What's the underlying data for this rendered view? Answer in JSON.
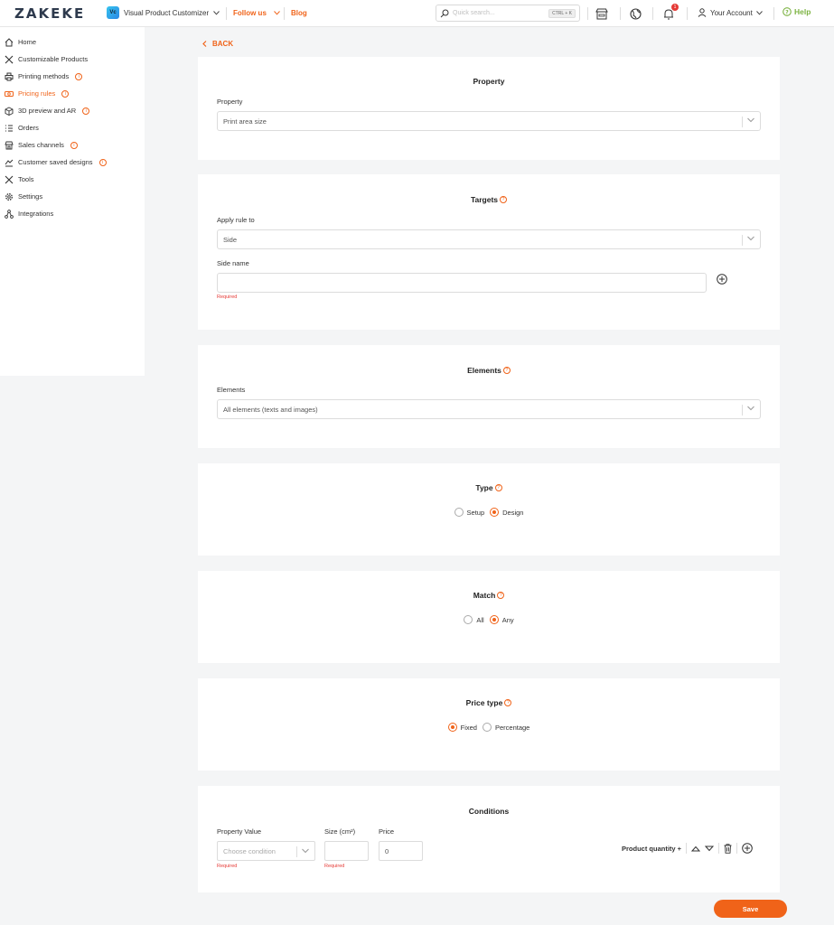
{
  "topbar": {
    "logo": "ZAKEKE",
    "app_badge": "Vc",
    "app_name": "Visual Product Customizer",
    "follow": "Follow us",
    "blog": "Blog",
    "search_placeholder": "Quick search...",
    "search_shortcut": "CTRL + K",
    "notification_count": "1",
    "account": "Your Account",
    "help": "Help"
  },
  "sidebar": {
    "items": [
      {
        "label": "Home",
        "icon": "home-icon"
      },
      {
        "label": "Customizable Products",
        "icon": "tools-icon"
      },
      {
        "label": "Printing methods",
        "icon": "printer-icon",
        "info": true
      },
      {
        "label": "Pricing rules",
        "icon": "price-tag-icon",
        "info": true,
        "active": true
      },
      {
        "label": "3D preview and AR",
        "icon": "cube-icon",
        "info": true
      },
      {
        "label": "Orders",
        "icon": "list-icon"
      },
      {
        "label": "Sales channels",
        "icon": "store-icon",
        "info": true
      },
      {
        "label": "Customer saved designs",
        "icon": "designs-icon",
        "info": true
      },
      {
        "label": "Tools",
        "icon": "wrench-icon"
      },
      {
        "label": "Settings",
        "icon": "gear-icon"
      },
      {
        "label": "Integrations",
        "icon": "integrations-icon"
      }
    ]
  },
  "back": "BACK",
  "property": {
    "title": "Property",
    "label": "Property",
    "value": "Print area size"
  },
  "targets": {
    "title": "Targets",
    "apply_label": "Apply rule to",
    "apply_value": "Side",
    "side_name_label": "Side name",
    "side_name_value": "",
    "required": "Required"
  },
  "elements": {
    "title": "Elements",
    "label": "Elements",
    "value": "All elements (texts and images)"
  },
  "type": {
    "title": "Type",
    "options": [
      {
        "label": "Setup",
        "selected": false
      },
      {
        "label": "Design",
        "selected": true
      }
    ]
  },
  "match": {
    "title": "Match",
    "options": [
      {
        "label": "All",
        "selected": false
      },
      {
        "label": "Any",
        "selected": true
      }
    ]
  },
  "price_type": {
    "title": "Price type",
    "options": [
      {
        "label": "Fixed",
        "selected": true
      },
      {
        "label": "Percentage",
        "selected": false
      }
    ]
  },
  "conditions": {
    "title": "Conditions",
    "property_value_label": "Property Value",
    "property_value_placeholder": "Choose condition",
    "size_label": "Size (cm²)",
    "size_value": "",
    "price_label": "Price",
    "price_value": "0",
    "required": "Required",
    "product_quantity": "Product quantity +"
  },
  "save": "Save",
  "colors": {
    "accent": "#f06319",
    "help": "#7cb342",
    "required": "#e53935"
  }
}
